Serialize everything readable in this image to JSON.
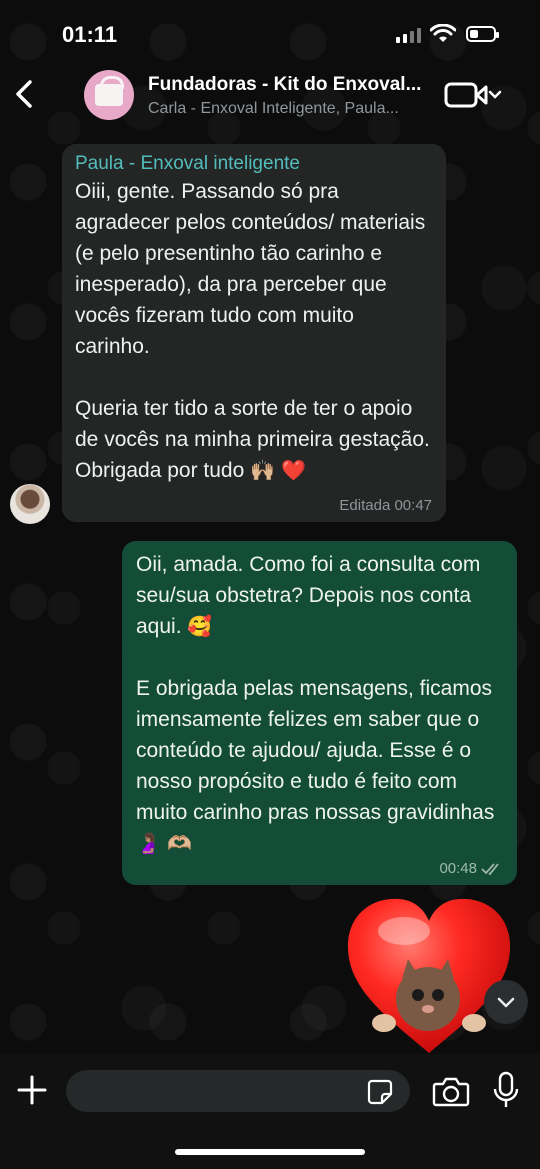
{
  "status_bar": {
    "time": "01:11"
  },
  "header": {
    "group_name": "Fundadoras - Kit do Enxoval...",
    "participants": "Carla - Enxoval Inteligente, Paula..."
  },
  "messages": {
    "incoming": {
      "sender": "Paula - Enxoval inteligente",
      "text": "Oiii, gente. Passando só pra agradecer pelos conteúdos/ materiais (e pelo presentinho tão carinho e inesperado), da pra perceber que vocês fizeram tudo com muito carinho.\n\nQueria ter tido a sorte de ter o apoio de vocês na minha primeira gestação. Obrigada por tudo",
      "emojis": "🙌🏼 ❤️",
      "meta": "Editada 00:47"
    },
    "outgoing": {
      "text_1": "Oii, amada. Como foi a consulta com seu/sua obstetra? Depois nos conta aqui.",
      "emoji_1": "🥰",
      "text_2": "E obrigada pelas mensagens, ficamos imensamente felizes em saber que o conteúdo te ajudou/ ajuda. Esse é o nosso propósito e tudo é feito com muito carinho pras nossas gravidinhas",
      "emoji_2": "🤰🏽 🫶🏼",
      "time": "00:48"
    }
  },
  "input": {
    "placeholder": ""
  },
  "colors": {
    "incoming_bubble": "#242626",
    "outgoing_bubble": "#144d37",
    "sender_name": "#53bdbb",
    "background": "#0b0b0b"
  },
  "icons": [
    "back-chevron-icon",
    "video-call-icon",
    "chevron-down-icon",
    "plus-icon",
    "sticker-icon",
    "camera-icon",
    "microphone-icon",
    "double-check-icon"
  ]
}
